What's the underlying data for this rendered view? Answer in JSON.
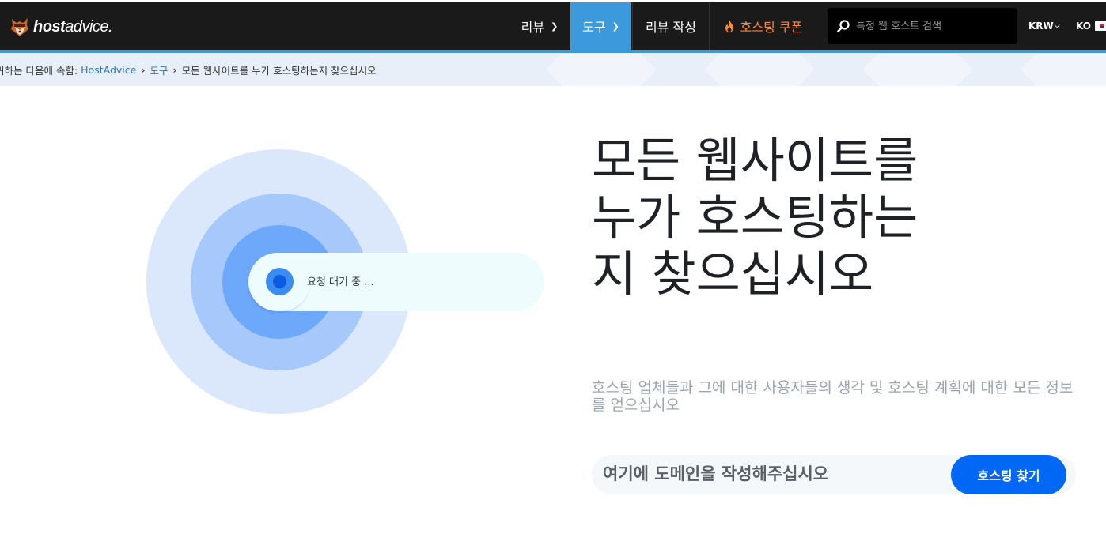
{
  "header": {
    "logo": {
      "brand_bold": "host",
      "brand_rest": "advice.",
      "icon": "fox-mascot-icon"
    },
    "nav": {
      "reviews": "리뷰",
      "tools": "도구",
      "write_review": "리뷰 작성",
      "coupons": "호스팅 쿠폰"
    },
    "search": {
      "placeholder": "특정 웹 호스트 검색",
      "value": ""
    },
    "currency": "KRW",
    "language": "KO"
  },
  "breadcrumb": {
    "prefix": "귀하는 다음에 속함:",
    "items": [
      "HostAdvice",
      "도구"
    ],
    "current": "모든 웹사이트를 누가 호스팅하는지 찾으십시오"
  },
  "illustration": {
    "status": "요청 대기 중 ..."
  },
  "hero": {
    "title": "모든 웹사이트를 누가 호스팅하는지 찾으십시오",
    "subtitle": "호스팅 업체들과 그에 대한 사용자들의 생각 및 호스팅 계획에 대한 모든 정보를 얻으십시오",
    "domain_placeholder": "여기에 도메인을 작성해주십시오",
    "domain_value": "",
    "button": "호스팅 찾기"
  },
  "colors": {
    "nav_bg": "#1a1a1a",
    "accent_blue": "#3b99dc",
    "coupon_orange": "#ff8a2a",
    "cta_blue": "#0068f5",
    "radar_outer": "#dbe8fb",
    "radar_mid": "#a6c8fb",
    "radar_inner": "#6ea8fb"
  }
}
